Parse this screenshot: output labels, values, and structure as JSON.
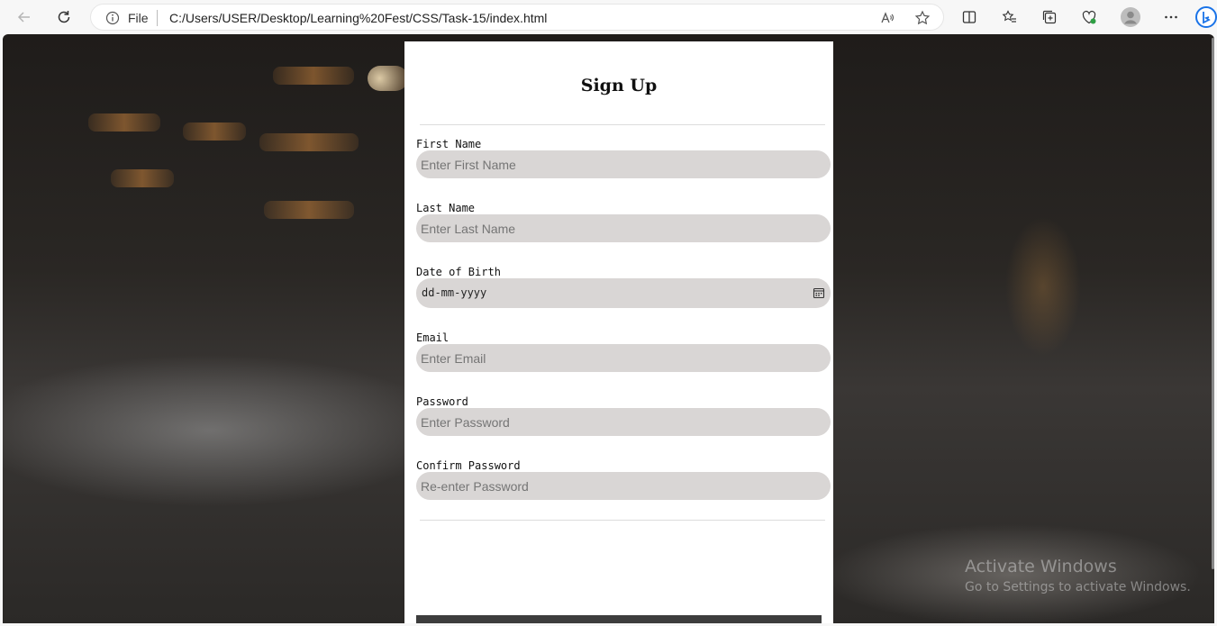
{
  "browser": {
    "address": {
      "scheme_label": "File",
      "url": "C:/Users/USER/Desktop/Learning%20Fest/CSS/Task-15/index.html"
    }
  },
  "form": {
    "title": "Sign Up",
    "fields": [
      {
        "label": "First Name",
        "placeholder": "Enter First Name",
        "type": "text"
      },
      {
        "label": "Last Name",
        "placeholder": "Enter Last Name",
        "type": "text"
      },
      {
        "label": "Date of Birth",
        "placeholder": "dd-mm-yyyy",
        "type": "date"
      },
      {
        "label": "Email",
        "placeholder": "Enter Email",
        "type": "email"
      },
      {
        "label": "Password",
        "placeholder": "Enter Password",
        "type": "password"
      },
      {
        "label": "Confirm Password",
        "placeholder": "Re-enter Password",
        "type": "password"
      }
    ]
  },
  "watermark": {
    "line1": "Activate Windows",
    "line2": "Go to Settings to activate Windows."
  }
}
